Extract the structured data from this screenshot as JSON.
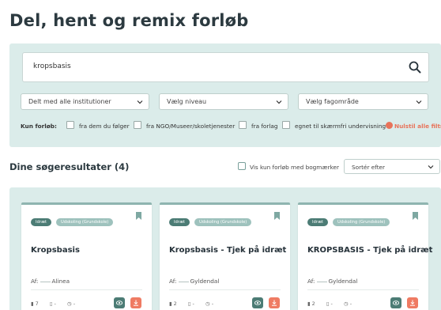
{
  "page": {
    "title": "Del, hent og remix forløb"
  },
  "search": {
    "value": "kropsbasis"
  },
  "selects": {
    "institutions": "Delt med alle institutioner",
    "level": "Vælg niveau",
    "subject": "Vælg fagområde"
  },
  "filters": {
    "label": "Kun forløb:",
    "options": [
      "fra dem du følger",
      "fra NGO/Museer/skoletjenester",
      "fra forlag",
      "egnet til skærmfri undervisning"
    ],
    "reset": "Nulstil alle filtre"
  },
  "results": {
    "heading": "Dine søgeresultater (4)",
    "bookmark_only": "Vis kun forløb med bogmærker",
    "sort": "Sortér efter"
  },
  "cards": [
    {
      "subject": "Idræt",
      "level": "Udskoling (Grundskole)",
      "title": "Kropsbasis",
      "author_prefix": "Af:",
      "author": "Alinea",
      "count": "7",
      "docs": "-",
      "time": "-"
    },
    {
      "subject": "Idræt",
      "level": "Udskoling (Grundskole)",
      "title": "Kropsbasis - Tjek på idræt",
      "author_prefix": "Af:",
      "author": "Gyldendal",
      "count": "2",
      "docs": "-",
      "time": "-"
    },
    {
      "subject": "Idræt",
      "level": "Udskoling (Grundskole)",
      "title": "KROPSBASIS - Tjek på idræt",
      "author_prefix": "Af:",
      "author": "Gyldendal",
      "count": "2",
      "docs": "-",
      "time": "-"
    }
  ],
  "colors": {
    "panel": "#dbecea",
    "accent": "#4c7c75",
    "reset": "#e8735a",
    "download": "#ef7b63"
  }
}
